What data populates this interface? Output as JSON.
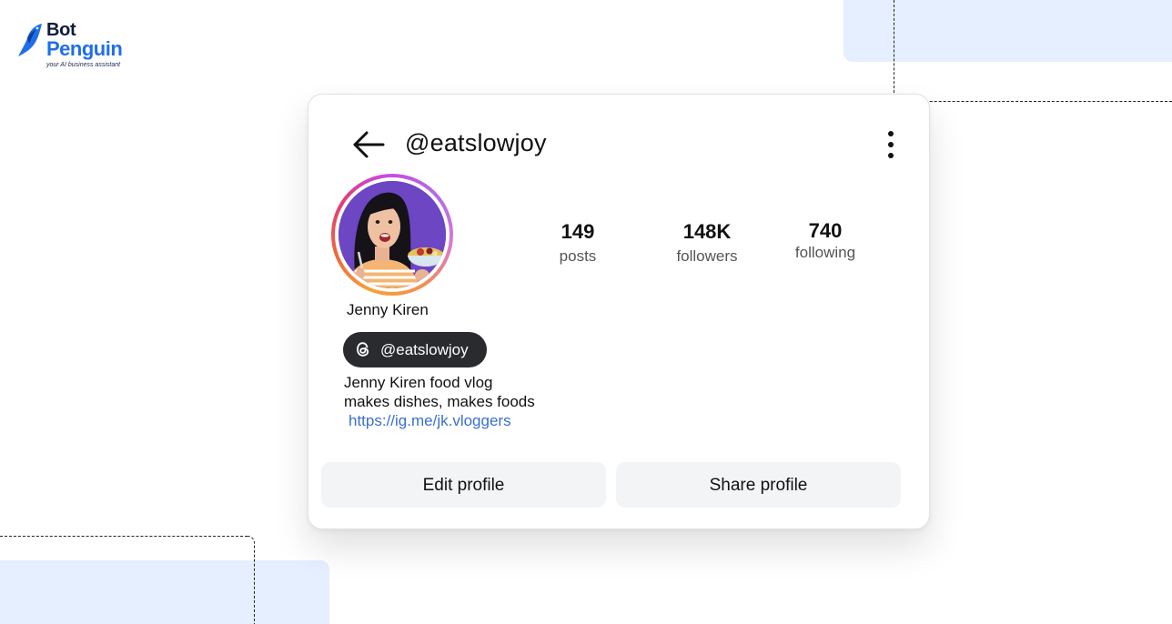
{
  "brand": {
    "name_line1": "Bot",
    "name_line2": "Penguin",
    "tagline": "your AI business assistant",
    "colors": {
      "primary": "#1f6fea",
      "dark": "#0f1b3d",
      "accent_bg": "#e6efff"
    }
  },
  "profile": {
    "handle": "@eatslowjoy",
    "display_name": "Jenny Kiren",
    "threads_handle": "@eatslowjoy",
    "bio_lines": [
      "Jenny Kiren food vlog",
      "makes dishes, makes foods"
    ],
    "link": "https://ig.me/jk.vloggers",
    "avatar_icon": "profile-photo"
  },
  "stats": {
    "posts": {
      "value": "149",
      "label": "posts"
    },
    "followers": {
      "value": "148K",
      "label": "followers"
    },
    "following": {
      "value": "740",
      "label": "following"
    }
  },
  "actions": {
    "edit_label": "Edit profile",
    "share_label": "Share profile"
  },
  "icons": {
    "back": "arrow-left-icon",
    "menu": "more-vertical-icon",
    "threads": "threads-icon"
  }
}
